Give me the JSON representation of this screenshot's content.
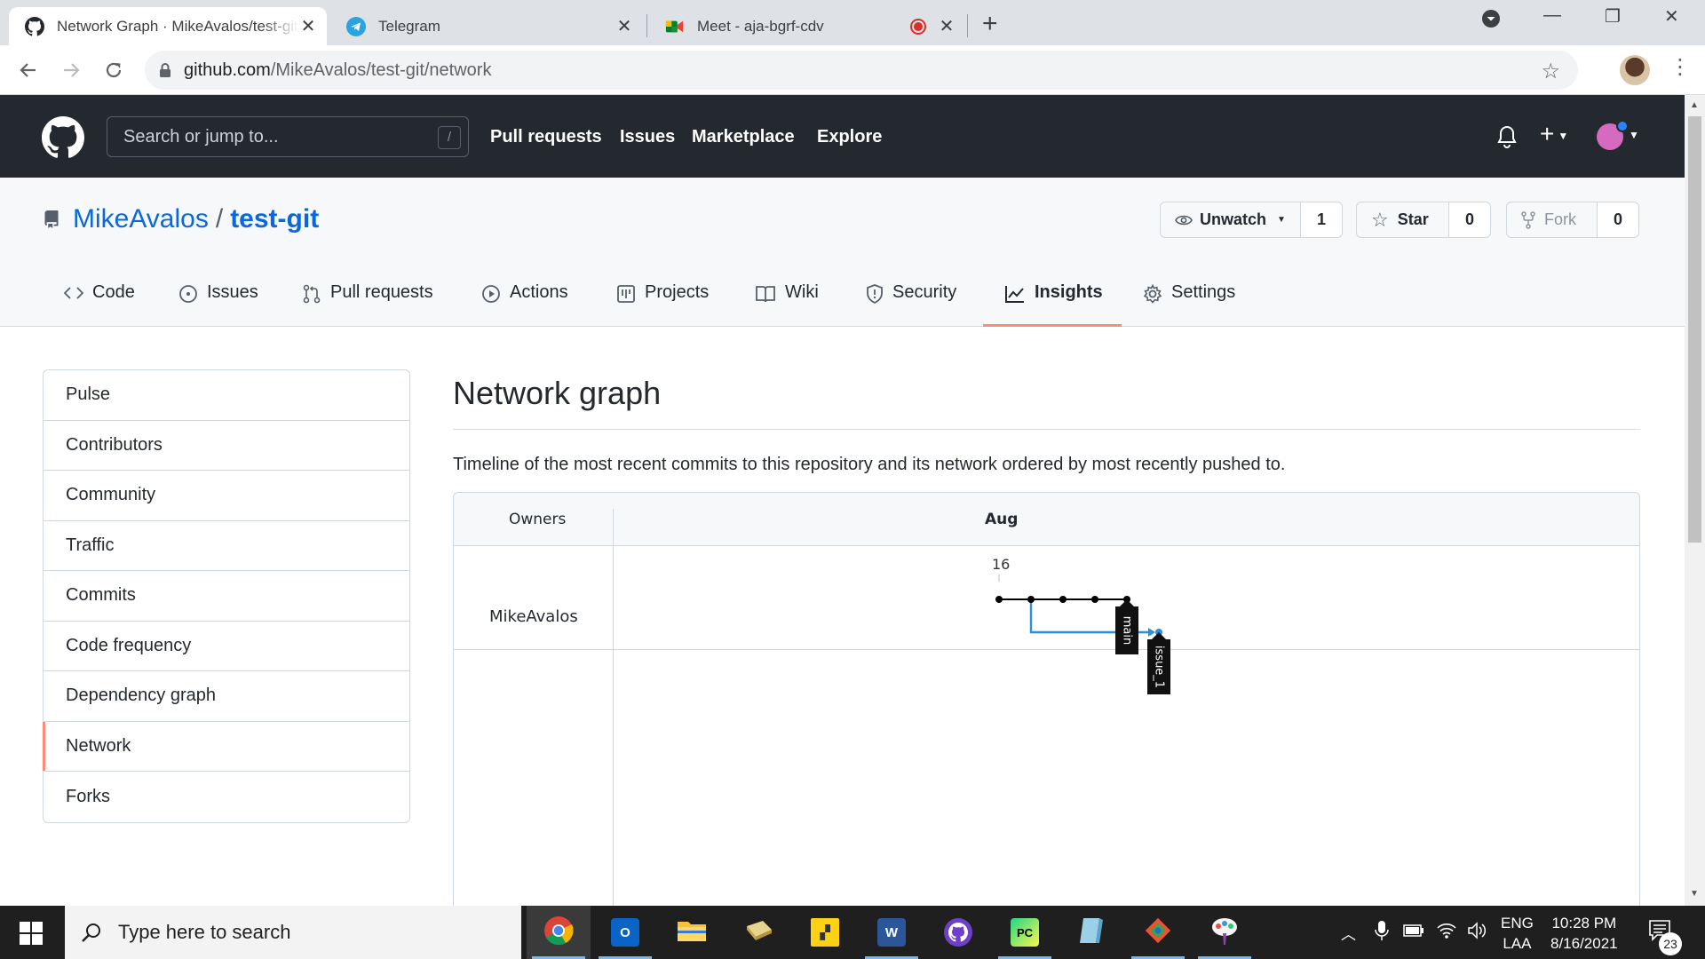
{
  "browser": {
    "tabs": [
      {
        "title": "Network Graph · MikeAvalos/test-git",
        "icon": "github-icon",
        "active": true
      },
      {
        "title": "Telegram",
        "icon": "telegram-icon",
        "active": false
      },
      {
        "title": "Meet - aja-bgrf-cdv",
        "icon": "google-meet-icon",
        "active": false,
        "recording": true
      }
    ],
    "new_tab": "+",
    "url_host": "github.com",
    "url_path": "/MikeAvalos/test-git/network"
  },
  "github": {
    "search_placeholder": "Search or jump to...",
    "search_shortcut": "/",
    "nav": [
      "Pull requests",
      "Issues",
      "Marketplace",
      "Explore"
    ]
  },
  "repo": {
    "owner": "MikeAvalos",
    "separator": "/",
    "name": "test-git",
    "watch": {
      "label": "Unwatch",
      "count": "1"
    },
    "star": {
      "label": "Star",
      "count": "0"
    },
    "fork": {
      "label": "Fork",
      "count": "0"
    },
    "tabs": [
      {
        "label": "Code",
        "icon": "code-icon"
      },
      {
        "label": "Issues",
        "icon": "issue-opened-icon"
      },
      {
        "label": "Pull requests",
        "icon": "git-pull-request-icon"
      },
      {
        "label": "Actions",
        "icon": "play-icon"
      },
      {
        "label": "Projects",
        "icon": "project-icon"
      },
      {
        "label": "Wiki",
        "icon": "book-icon"
      },
      {
        "label": "Security",
        "icon": "shield-icon"
      },
      {
        "label": "Insights",
        "icon": "graph-icon",
        "selected": true
      },
      {
        "label": "Settings",
        "icon": "gear-icon"
      }
    ]
  },
  "sidebar": {
    "items": [
      "Pulse",
      "Contributors",
      "Community",
      "Traffic",
      "Commits",
      "Code frequency",
      "Dependency graph",
      "Network",
      "Forks"
    ],
    "selected": "Network"
  },
  "main": {
    "title": "Network graph",
    "description": "Timeline of the most recent commits to this repository and its network ordered by most recently pushed to.",
    "graph": {
      "owners_header": "Owners",
      "month": "Aug",
      "day": "16",
      "owner": "MikeAvalos",
      "branches": [
        {
          "name": "main",
          "commits": 5,
          "color": "#000000"
        },
        {
          "name": "issue_1",
          "commits": 1,
          "color": "#2f8ce0",
          "branched_from_commit": 2
        }
      ]
    }
  },
  "taskbar": {
    "search_placeholder": "Type here to search",
    "apps": [
      "chrome-icon",
      "outlook-icon",
      "file-explorer-icon",
      "notes-icon",
      "sticky-notes-icon",
      "word-icon",
      "github-desktop-icon",
      "pycharm-icon",
      "app-icon",
      "git-icon",
      "paint-icon"
    ],
    "language": "ENG",
    "layout": "LAA",
    "time": "10:28 PM",
    "date": "8/16/2021",
    "notifications": "23"
  },
  "colors": {
    "accent_underline": "#fd8c73",
    "link": "#0969da",
    "header_bg": "#24292f"
  }
}
